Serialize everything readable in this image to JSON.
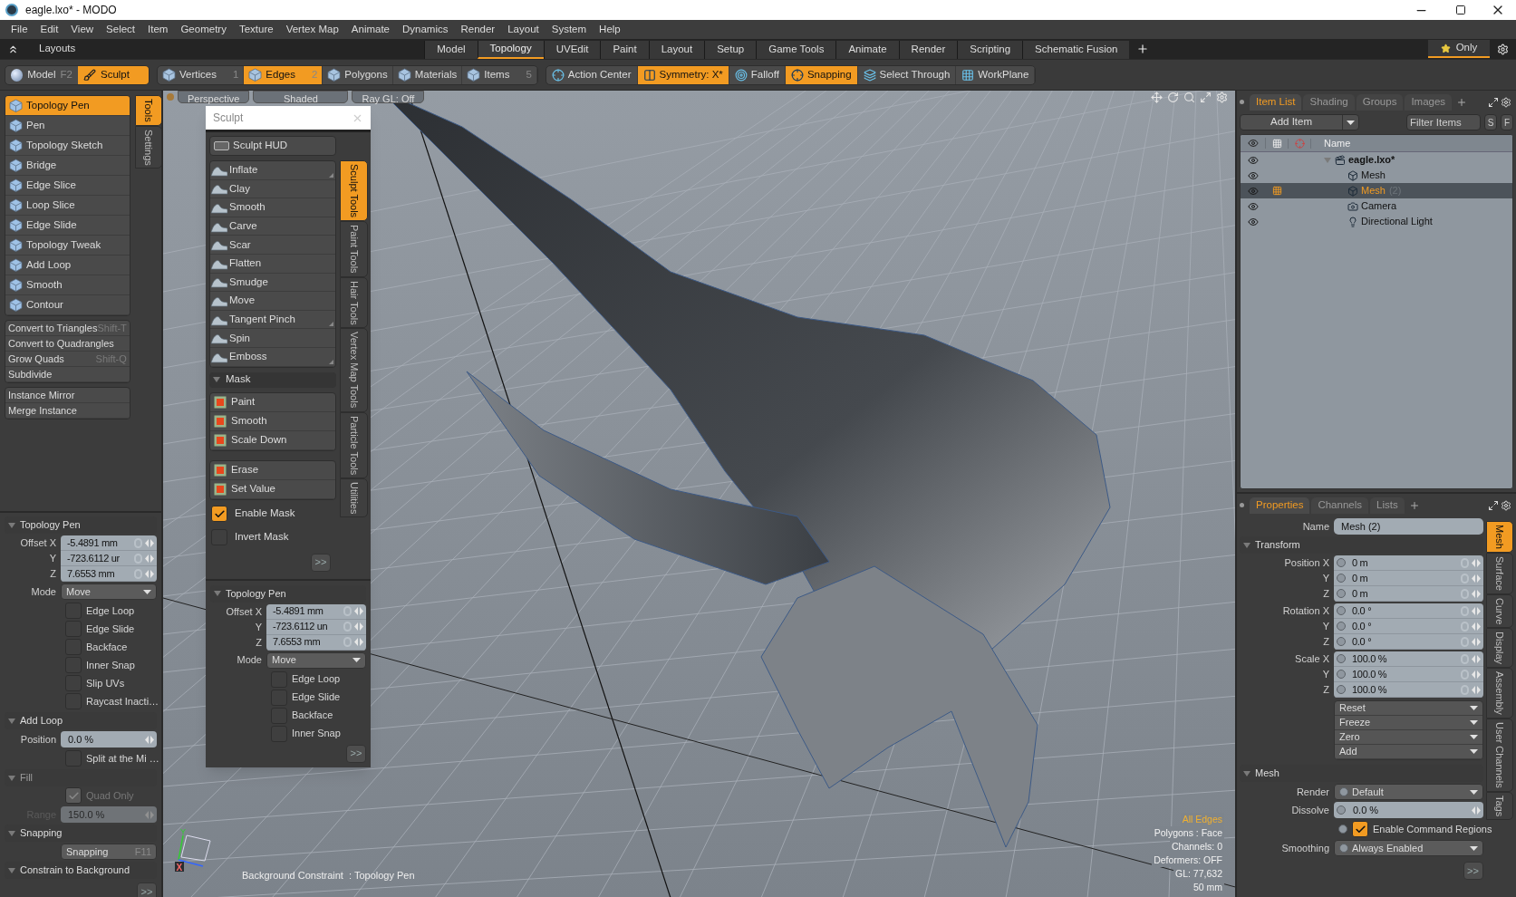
{
  "window": {
    "title": "eagle.lxo* - MODO"
  },
  "menu": [
    "File",
    "Edit",
    "View",
    "Select",
    "Item",
    "Geometry",
    "Texture",
    "Vertex Map",
    "Animate",
    "Dynamics",
    "Render",
    "Layout",
    "System",
    "Help"
  ],
  "layouts": {
    "label": "Layouts",
    "tabs": [
      {
        "label": "Model",
        "selected": false
      },
      {
        "label": "Topology",
        "selected": true
      },
      {
        "label": "UVEdit",
        "selected": false
      },
      {
        "label": "Paint",
        "selected": false
      },
      {
        "label": "Layout",
        "selected": false
      },
      {
        "label": "Setup",
        "selected": false
      },
      {
        "label": "Game Tools",
        "selected": false
      },
      {
        "label": "Animate",
        "selected": false
      },
      {
        "label": "Render",
        "selected": false
      },
      {
        "label": "Scripting",
        "selected": false
      },
      {
        "label": "Schematic Fusion",
        "selected": false
      }
    ],
    "favorites": "Only"
  },
  "toolbar": {
    "modes": [
      {
        "kind": "sphere",
        "label": "Model",
        "shortcut": "F2",
        "selected": false
      },
      {
        "kind": "brush",
        "label": "Sculpt",
        "selected": true
      }
    ],
    "selection": [
      {
        "label": "Vertices",
        "shortcut": "1",
        "selected": false
      },
      {
        "label": "Edges",
        "shortcut": "2",
        "selected": true
      },
      {
        "label": "Polygons",
        "selected": false
      },
      {
        "label": "Materials",
        "selected": false
      },
      {
        "label": "Items",
        "shortcut": "5",
        "selected": false
      }
    ],
    "options": [
      {
        "kind": "action_center",
        "label": "Action Center",
        "on": false
      },
      {
        "kind": "symmetry",
        "label": "Symmetry: X*",
        "on": true
      },
      {
        "kind": "falloff",
        "label": "Falloff",
        "on": false
      },
      {
        "kind": "snapping",
        "label": "Snapping",
        "on": true
      },
      {
        "kind": "select_through",
        "label": "Select Through",
        "on": false
      },
      {
        "kind": "workplane",
        "label": "WorkPlane",
        "on": false
      }
    ]
  },
  "tools": {
    "side_tabs": [
      {
        "label": "Tools",
        "selected": true
      },
      {
        "label": "Settings",
        "selected": false
      }
    ],
    "icon_tools": [
      {
        "label": "Topology Pen",
        "selected": true
      },
      {
        "label": "Pen",
        "selected": false
      },
      {
        "label": "Topology Sketch",
        "selected": false
      },
      {
        "label": "Bridge",
        "selected": false
      },
      {
        "label": "Edge Slice",
        "selected": false
      },
      {
        "label": "Loop Slice",
        "selected": false
      },
      {
        "label": "Edge Slide",
        "selected": false
      },
      {
        "label": "Topology Tweak",
        "selected": false
      },
      {
        "label": "Add Loop",
        "selected": false
      },
      {
        "label": "Smooth",
        "selected": false
      },
      {
        "label": "Contour",
        "selected": false
      }
    ],
    "command_groups": [
      [
        {
          "label": "Convert to Triangles",
          "shortcut": "Shift-T"
        },
        {
          "label": "Convert to Quadrangles"
        },
        {
          "label": "Grow Quads",
          "shortcut": "Shift-Q"
        },
        {
          "label": "Subdivide"
        }
      ],
      [
        {
          "label": "Instance Mirror"
        },
        {
          "label": "Merge Instance"
        }
      ]
    ]
  },
  "tool_properties": {
    "sections": [
      {
        "title": "Topology Pen",
        "expanded": true,
        "disabled": false,
        "rows": [
          {
            "kind": "vector",
            "lines": [
              {
                "label": "Offset X",
                "value": "-5.4891 mm"
              },
              {
                "label": "Y",
                "value": "-723.6112 ur"
              },
              {
                "label": "Z",
                "value": "7.6553 mm"
              }
            ]
          },
          {
            "kind": "dropdown",
            "label": "Mode",
            "value": "Move"
          },
          {
            "kind": "checkbox",
            "label": "Edge Loop",
            "checked": false
          },
          {
            "kind": "checkbox",
            "label": "Edge Slide",
            "checked": false
          },
          {
            "kind": "checkbox",
            "label": "Backface",
            "checked": false
          },
          {
            "kind": "checkbox",
            "label": "Inner Snap",
            "checked": false
          },
          {
            "kind": "checkbox",
            "label": "Slip UVs",
            "checked": false
          },
          {
            "kind": "checkbox",
            "label": "Raycast Inacti…",
            "checked": false
          }
        ]
      },
      {
        "title": "Add Loop",
        "expanded": true,
        "disabled": false,
        "rows": [
          {
            "kind": "number",
            "label": "Position",
            "value": "0.0 %"
          },
          {
            "kind": "checkbox",
            "label": "Split at the Mi …",
            "checked": false
          }
        ]
      },
      {
        "title": "Fill",
        "expanded": true,
        "disabled": true,
        "rows": [
          {
            "kind": "checkbox",
            "label": "Quad Only",
            "checked": true
          },
          {
            "kind": "number",
            "label": "Range",
            "value": "150.0 %"
          }
        ]
      },
      {
        "title": "Snapping",
        "expanded": true,
        "disabled": false,
        "rows": [
          {
            "kind": "button",
            "label": "Snapping",
            "shortcut": "F11"
          }
        ]
      },
      {
        "title": "Constrain to Background",
        "expanded": true,
        "disabled": false
      }
    ],
    "more": ">>"
  },
  "viewport": {
    "tabs": [
      "Perspective",
      "Shaded",
      "Ray GL: Off"
    ],
    "info": [
      {
        "text": "All Edges",
        "highlight": true
      },
      {
        "text": "Polygons : Face",
        "highlight": false
      },
      {
        "text": "Channels: 0",
        "highlight": false
      },
      {
        "text": "Deformers: OFF",
        "highlight": false
      },
      {
        "text": "GL: 77,632",
        "highlight": false
      },
      {
        "text": "50 mm",
        "highlight": false
      }
    ],
    "status": "Background Constraint  : Topology Pen",
    "axes": [
      "Y",
      "X"
    ]
  },
  "sculpt_panel": {
    "title": "Sculpt",
    "hud": "Sculpt HUD",
    "tools": [
      {
        "label": "Inflate",
        "submenu": true
      },
      {
        "label": "Clay",
        "submenu": false
      },
      {
        "label": "Smooth",
        "submenu": false
      },
      {
        "label": "Carve",
        "submenu": false
      },
      {
        "label": "Scar",
        "submenu": false
      },
      {
        "label": "Flatten",
        "submenu": false
      },
      {
        "label": "Smudge",
        "submenu": false
      },
      {
        "label": "Move",
        "submenu": false
      },
      {
        "label": "Tangent Pinch",
        "submenu": true
      },
      {
        "label": "Spin",
        "submenu": false
      },
      {
        "label": "Emboss",
        "submenu": true
      }
    ],
    "mask": {
      "title": "Mask",
      "expanded": true,
      "tools": [
        "Paint",
        "Smooth",
        "Scale Down"
      ],
      "actions": [
        "Erase",
        "Set Value"
      ],
      "options": [
        {
          "label": "Enable Mask",
          "checked": true
        },
        {
          "label": "Invert Mask",
          "checked": false
        }
      ],
      "more": ">>"
    },
    "side_tabs": [
      {
        "label": "Sculpt Tools",
        "selected": true
      },
      {
        "label": "Paint Tools",
        "selected": false
      },
      {
        "label": "Hair Tools",
        "selected": false
      },
      {
        "label": "Vertex Map Tools",
        "selected": false
      },
      {
        "label": "Particle Tools",
        "selected": false
      },
      {
        "label": "Utilities",
        "selected": false
      }
    ],
    "properties": {
      "sections": [
        {
          "title": "Topology Pen",
          "expanded": true,
          "disabled": false,
          "rows": [
            {
              "kind": "vector",
              "lines": [
                {
                  "label": "Offset X",
                  "value": "-5.4891 mm"
                },
                {
                  "label": "Y",
                  "value": "-723.6112 un"
                },
                {
                  "label": "Z",
                  "value": "7.6553 mm"
                }
              ]
            },
            {
              "kind": "dropdown",
              "label": "Mode",
              "value": "Move"
            },
            {
              "kind": "checkbox",
              "label": "Edge Loop",
              "checked": false
            },
            {
              "kind": "checkbox",
              "label": "Edge Slide",
              "checked": false
            },
            {
              "kind": "checkbox",
              "label": "Backface",
              "checked": false
            },
            {
              "kind": "checkbox",
              "label": "Inner Snap",
              "checked": false
            }
          ]
        }
      ],
      "more": ">>"
    }
  },
  "item_list": {
    "tabs": [
      {
        "label": "Item List",
        "selected": true
      },
      {
        "label": "Shading",
        "selected": false
      },
      {
        "label": "Groups",
        "selected": false
      },
      {
        "label": "Images",
        "selected": false
      }
    ],
    "add_button": "Add Item",
    "filter": {
      "placeholder": "Filter Items"
    },
    "filter_buttons": [
      "S",
      "F"
    ],
    "name_column": "Name",
    "tree": [
      {
        "name": "eagle.lxo*",
        "kind": "scene",
        "visible": true,
        "selected": false,
        "expanded": true,
        "children": [
          {
            "name": "Mesh",
            "kind": "mesh",
            "visible": true,
            "selected": false
          },
          {
            "name": "Mesh",
            "count": "(2)",
            "kind": "mesh",
            "visible": true,
            "selected": true
          },
          {
            "name": "Camera",
            "kind": "camera",
            "visible": true,
            "selected": false
          },
          {
            "name": "Directional Light",
            "kind": "light",
            "visible": true,
            "selected": false
          }
        ]
      }
    ]
  },
  "properties": {
    "tabs": [
      {
        "label": "Properties",
        "selected": true
      },
      {
        "label": "Channels",
        "selected": false
      },
      {
        "label": "Lists",
        "selected": false
      }
    ],
    "side_tabs": [
      {
        "label": "Mesh",
        "selected": true
      },
      {
        "label": "Surface",
        "selected": false
      },
      {
        "label": "Curve",
        "selected": false
      },
      {
        "label": "Display",
        "selected": false
      },
      {
        "label": "Assembly",
        "selected": false
      },
      {
        "label": "User Channels",
        "selected": false
      },
      {
        "label": "Tags",
        "selected": false
      }
    ],
    "name": {
      "label": "Name",
      "value": "Mesh (2)"
    },
    "sections": [
      {
        "title": "Transform",
        "expanded": true,
        "disabled": false,
        "rows": [
          {
            "kind": "vector",
            "lines": [
              {
                "label": "Position X",
                "value": "0 m"
              },
              {
                "label": "Y",
                "value": "0 m"
              },
              {
                "label": "Z",
                "value": "0 m"
              }
            ]
          },
          {
            "kind": "vector",
            "lines": [
              {
                "label": "Rotation X",
                "value": "0.0 °"
              },
              {
                "label": "Y",
                "value": "0.0 °"
              },
              {
                "label": "Z",
                "value": "0.0 °"
              }
            ]
          },
          {
            "kind": "vector",
            "lines": [
              {
                "label": "Scale X",
                "value": "100.0 %"
              },
              {
                "label": "Y",
                "value": "100.0 %"
              },
              {
                "label": "Z",
                "value": "100.0 %"
              }
            ]
          },
          {
            "kind": "menu",
            "items": [
              "Reset",
              "Freeze",
              "Zero",
              "Add"
            ]
          }
        ]
      },
      {
        "title": "Mesh",
        "expanded": true,
        "disabled": false,
        "rows": [
          {
            "kind": "dropdown",
            "label": "Render",
            "value": "Default"
          },
          {
            "kind": "number",
            "label": "Dissolve",
            "value": "0.0 %"
          },
          {
            "kind": "checkbox",
            "label": "Enable Command Regions",
            "checked": true
          },
          {
            "kind": "dropdown",
            "label": "Smoothing",
            "value": "Always Enabled"
          }
        ]
      }
    ],
    "more": ">>"
  }
}
